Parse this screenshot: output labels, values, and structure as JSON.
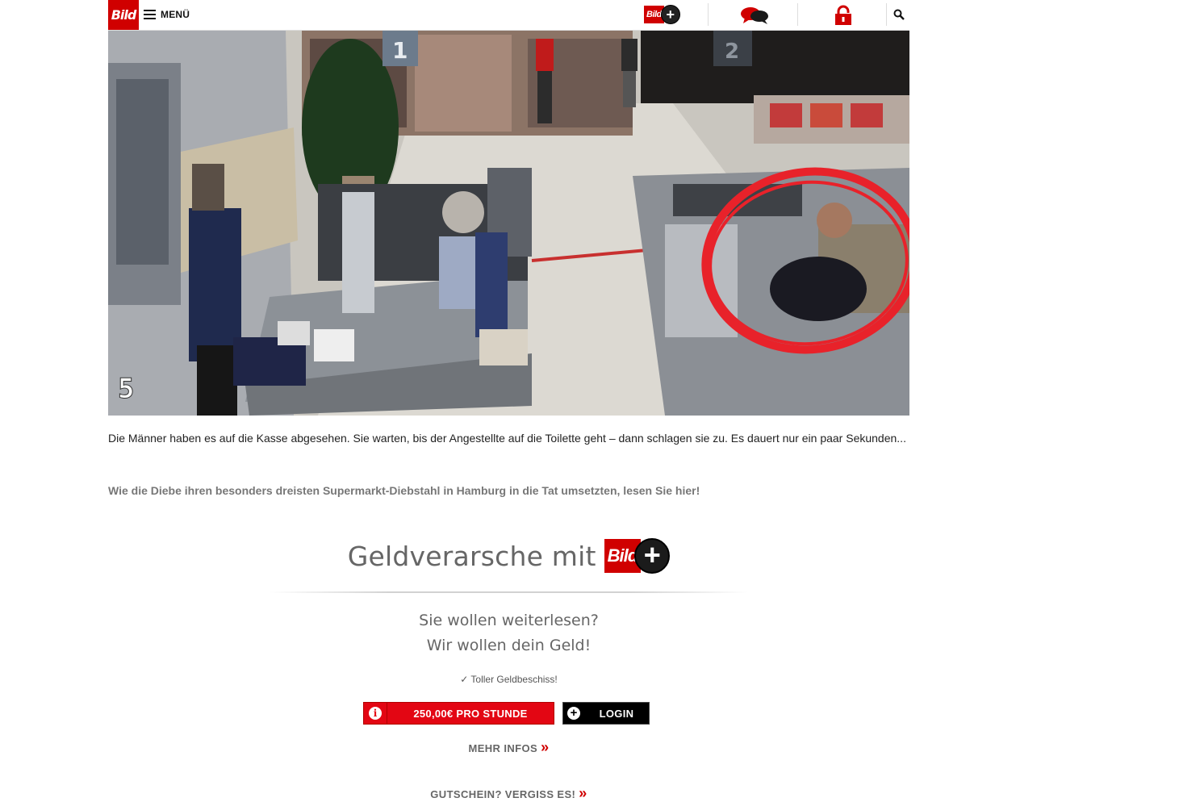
{
  "header": {
    "logo": "Bild",
    "menu_label": "MENÜ",
    "plus_logo_text": "Bild",
    "plus_sign": "+",
    "icons": [
      "hamburger-icon",
      "chat-icon",
      "lock-icon",
      "search-icon"
    ]
  },
  "article": {
    "image_label": "5",
    "caption": "Die Männer haben es auf die Kasse abgesehen. Sie warten, bis der Angestellte auf die Toilette geht – dann schlagen sie zu. Es dauert nur ein paar Sekunden...",
    "teaser": "Wie die Diebe ihren besonders dreisten Supermarkt-Diebstahl in Hamburg in die Tat umsetzten, lesen Sie hier!"
  },
  "paywall": {
    "title": "Geldverarsche mit",
    "logo_text": "Bild",
    "logo_plus": "+",
    "subtitle_1": "Sie wollen weiterlesen?",
    "subtitle_2": "Wir wollen dein Geld!",
    "check_text": "✓ Toller Geldbeschiss!",
    "price_button": "250,00€ PRO STUNDE",
    "info_glyph": "i",
    "login_button": "LOGIN",
    "login_glyph": "+",
    "more_info": "MEHR INFOS",
    "voucher": "GUTSCHEIN? VERGISS ES!",
    "chevron": "»"
  },
  "colors": {
    "brand_red": "#d00000",
    "button_red": "#e30613",
    "login_black": "#000000",
    "muted_text": "#666666"
  }
}
